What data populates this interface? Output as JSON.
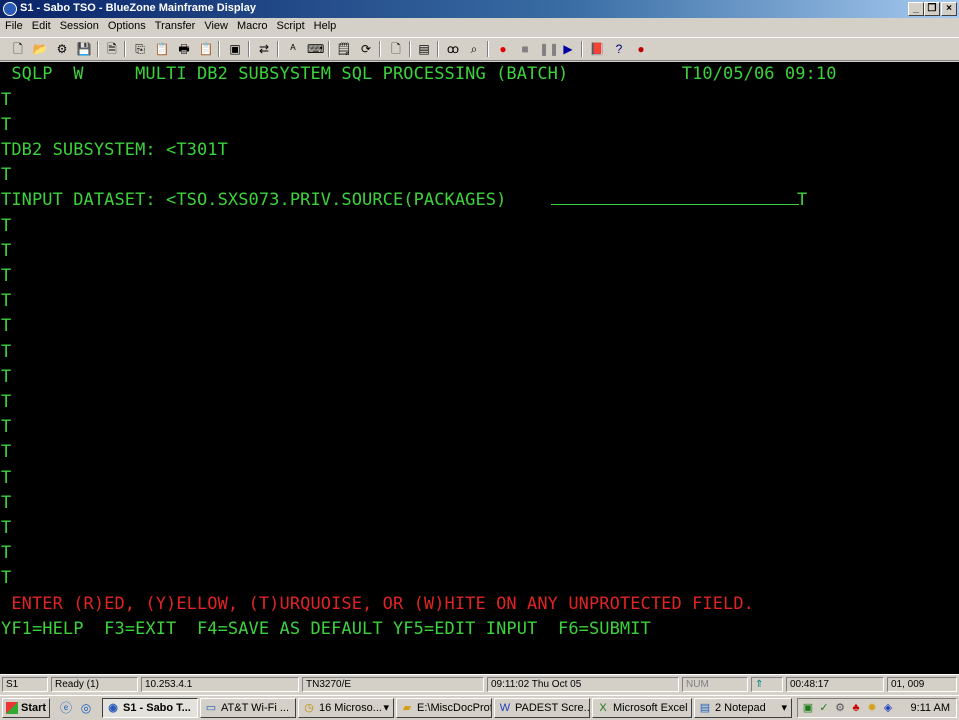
{
  "window": {
    "title": "S1 - Sabo TSO - BlueZone Mainframe Display",
    "minimize_label": "_",
    "restore_label": "❐",
    "close_label": "×"
  },
  "menu": [
    "File",
    "Edit",
    "Session",
    "Options",
    "Transfer",
    "View",
    "Macro",
    "Script",
    "Help"
  ],
  "screen": {
    "header": " SQLP  W     MULTI DB2 SUBSYSTEM SQL PROCESSING (BATCH)           T10/05/06 09:10",
    "lines": [
      "T",
      "T",
      "TDB2 SUBSYSTEM: <T301T",
      "T",
      "TINPUT DATASET: <TSO.SXS073.PRIV.SOURCE(PACKAGES)",
      "T",
      "T",
      "T",
      "T",
      "T",
      "T",
      "T",
      "T",
      "T",
      "T",
      "T",
      "T",
      "T",
      "T",
      "T"
    ],
    "field_end": "T",
    "message": " ENTER (R)ED, (Y)ELLOW, (T)URQUOISE, OR (W)HITE ON ANY UNPROTECTED FIELD.",
    "fkeys": "YF1=HELP  F3=EXIT  F4=SAVE AS DEFAULT YF5=EDIT INPUT  F6=SUBMIT"
  },
  "status": {
    "session": "S1",
    "state": "Ready (1)",
    "ip": "10.253.4.1",
    "terminal": "TN3270/E",
    "datetime": "09:11:02  Thu Oct 05",
    "num": "NUM",
    "arrow": "⇑",
    "elapsed": "00:48:17",
    "cursor": "01, 009"
  },
  "taskbar": {
    "start_label": "Start",
    "tasks": [
      {
        "label": "S1 - Sabo T...",
        "icon": "bluezone-icon"
      },
      {
        "label": "AT&T Wi-Fi ...",
        "icon": "window-icon"
      },
      {
        "label": "16 Microso...",
        "icon": "outlook-icon"
      },
      {
        "label": "E:\\MiscDocProf",
        "icon": "folder-icon"
      },
      {
        "label": "PADEST Scre...",
        "icon": "word-icon"
      },
      {
        "label": "Microsoft Excel",
        "icon": "excel-icon"
      },
      {
        "label": "2 Notepad",
        "icon": "notepad-icon"
      }
    ],
    "clock": "9:11 AM"
  }
}
